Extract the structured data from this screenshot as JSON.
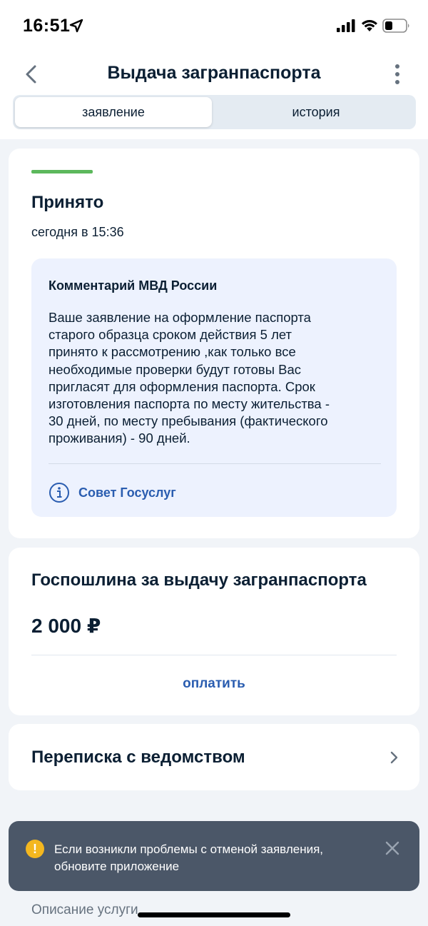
{
  "status_bar": {
    "time": "16:51"
  },
  "header": {
    "title": "Выдача загранпаспорта",
    "tabs": [
      {
        "label": "заявление",
        "active": true
      },
      {
        "label": "история",
        "active": false
      }
    ]
  },
  "status_card": {
    "status": "Принято",
    "status_color": "#5cb85c",
    "time": "сегодня в 15:36",
    "comment": {
      "title": "Комментарий МВД России",
      "lines": [
        "Ваше заявление на оформление паспорта",
        "старого образца сроком действия 5 лет",
        "принято к рассмотрению ,как только все",
        "необходимые проверки будут готовы Вас",
        "пригласят для оформления паспорта. Срок",
        "изготовления паспорта по месту жительства -",
        "30 дней, по месту пребывания (фактического",
        "проживания) - 90 дней."
      ],
      "advice_label": "Совет Госуслуг"
    }
  },
  "fee_card": {
    "title": "Госпошлина за выдачу загранпаспорта",
    "amount": "2 000 ₽",
    "pay_label": "оплатить"
  },
  "chat_card": {
    "title": "Переписка с ведомством"
  },
  "toast": {
    "icon": "!",
    "lines": [
      "Если возникли проблемы с отменой заявления,",
      "обновите приложение"
    ]
  },
  "description_link": "Описание услуги",
  "colors": {
    "accent_link": "#2a5db0",
    "toast_bg": "#4b5768",
    "warning": "#f4b71f"
  }
}
